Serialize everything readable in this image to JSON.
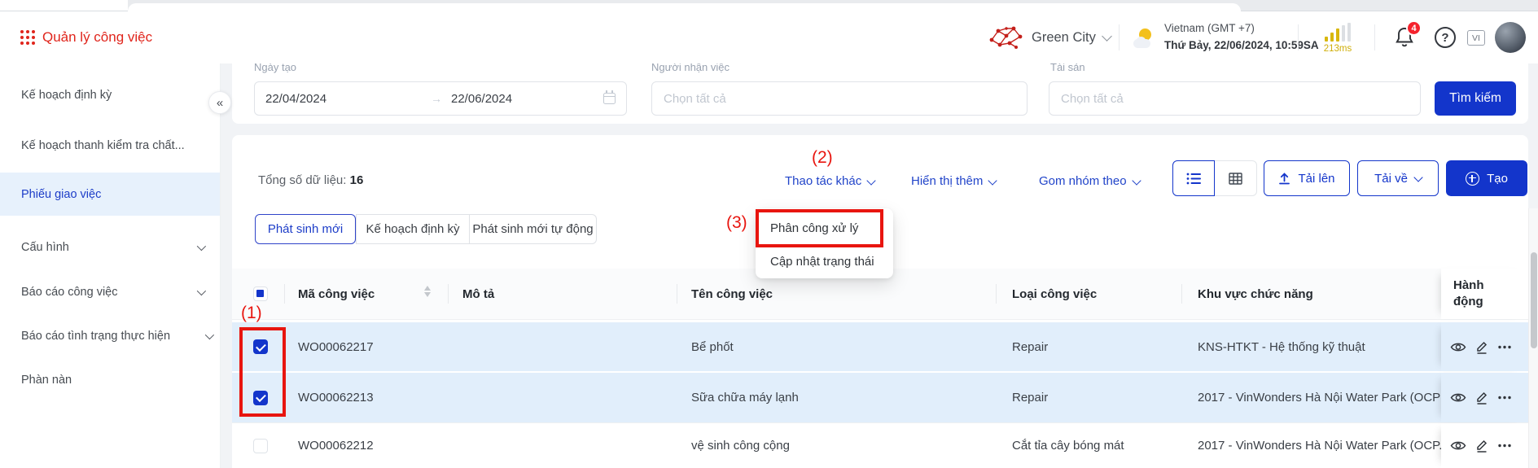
{
  "app": {
    "title": "Quản lý công việc"
  },
  "header": {
    "org_name": "Green City",
    "region": "Vietnam (GMT +7)",
    "datetime": "Thứ Bảy, 22/06/2024, 10:59SA",
    "latency": "213ms",
    "notification_count": "4",
    "help_label": "?",
    "language": "VI"
  },
  "sidebar": {
    "collapse": "«",
    "items": [
      {
        "label": "Kế hoạch định kỳ"
      },
      {
        "label": "Kế hoạch thanh kiểm tra chất..."
      },
      {
        "label": "Phiếu giao việc"
      },
      {
        "label": "Cấu hình"
      },
      {
        "label": "Báo cáo công việc"
      },
      {
        "label": "Báo cáo tình trạng thực hiện"
      },
      {
        "label": "Phàn nàn"
      }
    ]
  },
  "filters": {
    "date_label": "Ngày tạo",
    "date_from": "22/04/2024",
    "date_arrow": "→",
    "date_to": "22/06/2024",
    "assignee_label": "Người nhận việc",
    "assignee_placeholder": "Chọn tất cả",
    "asset_label": "Tài sản",
    "asset_placeholder": "Chọn tất cả",
    "search_label": "Tìm kiếm"
  },
  "toolbar": {
    "total_label": "Tổng số dữ liệu: ",
    "total_value": "16",
    "more_actions_label": "Thao tác khác",
    "show_more_label": "Hiển thị thêm",
    "group_by_label": "Gom nhóm theo",
    "upload_label": "Tải lên",
    "download_label": "Tải về",
    "create_label": "Tạo"
  },
  "more_actions_menu": {
    "items": [
      {
        "label": "Phân công xử lý"
      },
      {
        "label": "Cập nhật trạng thái"
      }
    ]
  },
  "tabs": [
    {
      "label": "Phát sinh mới"
    },
    {
      "label": "Kế hoạch định kỳ"
    },
    {
      "label": "Phát sinh mới tự động"
    }
  ],
  "table": {
    "columns": {
      "code": "Mã công việc",
      "description": "Mô tả",
      "name": "Tên công việc",
      "type": "Loại công việc",
      "area": "Khu vực chức năng",
      "actions": "Hành động"
    },
    "rows": [
      {
        "code": "WO00062217",
        "description": "",
        "name": "Bể phốt",
        "type": "Repair",
        "area": "KNS-HTKT - Hệ thống kỹ thuật",
        "checked": true
      },
      {
        "code": "WO00062213",
        "description": "",
        "name": "Sữa chữa máy lạnh",
        "type": "Repair",
        "area": "2017 - VinWonders Hà Nội Water Park (OCP",
        "checked": true
      },
      {
        "code": "WO00062212",
        "description": "",
        "name": "vệ sinh công cộng",
        "type": "Cắt tỉa cây bóng mát",
        "area": "2017 - VinWonders Hà Nội Water Park (OCP.",
        "checked": false
      }
    ]
  },
  "annotations": {
    "step1": "(1)",
    "step2": "(2)",
    "step3": "(3)"
  },
  "colors": {
    "brand_red": "#e0251c",
    "accent_blue": "#1335cb",
    "link_blue": "#2144c9",
    "annotation_red": "#e8150f",
    "selected_row": "#e1eefb",
    "badge_red": "#f5222d",
    "latency_gold": "#d8b70d"
  }
}
